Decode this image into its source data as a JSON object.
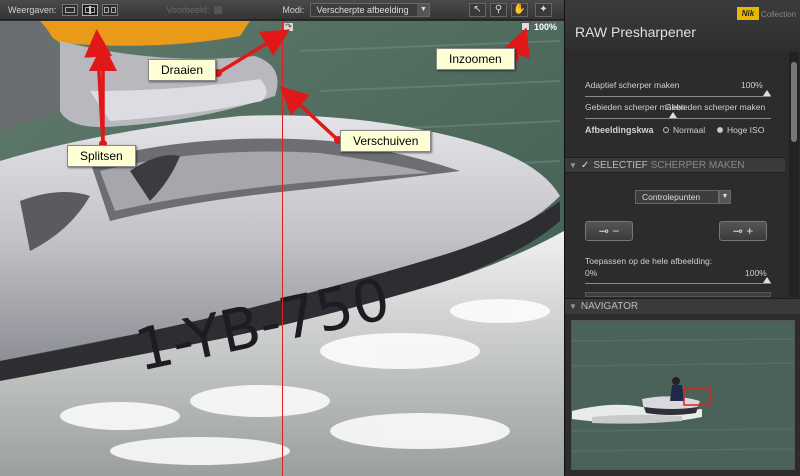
{
  "toolbar": {
    "weergaven_label": "Weergaven:",
    "voorbeeld_label": "Voorbeeld:",
    "modi_label": "Modi:",
    "modi_value": "Verscherpte afbeelding",
    "tools": [
      "pointer-icon",
      "zoom-icon",
      "hand-icon",
      "pin-icon"
    ]
  },
  "photo": {
    "plate_text": "1-YB-750",
    "zoom_level": "100%"
  },
  "callouts": {
    "draaien": "Draaien",
    "inzoomen": "Inzoomen",
    "verschuiven": "Verschuiven",
    "splitsen": "Splitsen"
  },
  "panel": {
    "logo": "Nik",
    "logo_sub": "Collection",
    "title": "RAW Presharpener",
    "adaptief_label": "Adaptief scherper maken",
    "adaptief_value": "100%",
    "gebieden_label": "Gebieden scherper maken",
    "gebieden_overlap": "Gebieden scherper maken",
    "kwaliteit_label": "Afbeeldingskwa",
    "opt_normaal": "Normaal",
    "opt_hoge_iso": "Hoge ISO",
    "section_title_a": "SELECTIEF",
    "section_title_b": "SCHERPER MAKEN",
    "controlepunten": "Controlepunten",
    "pipette_minus": "−",
    "pipette_plus": "+",
    "toepassen_label": "Toepassen op de hele afbeelding:",
    "toepassen_min": "0%",
    "toepassen_max": "100%",
    "navigator_title": "NAVIGATOR"
  },
  "colors": {
    "accent_red": "#e02020",
    "callout_bg": "#ffffd6",
    "logo_yellow": "#e8b800"
  }
}
